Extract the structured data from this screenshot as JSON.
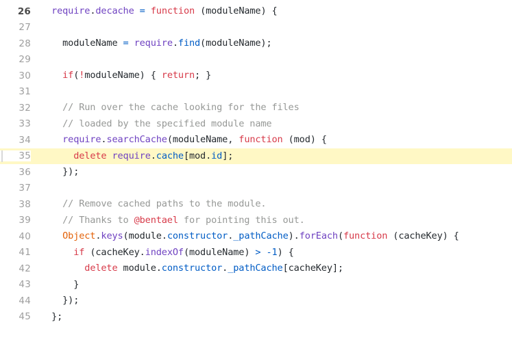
{
  "viewer": {
    "name": "code-blob-viewer",
    "language": "JavaScript",
    "first_line": 26,
    "last_line": 45,
    "highlighted_line": 35,
    "background": "#ffffff",
    "highlight_color": "#fff8c5",
    "gutter_marker_color": "#d8d8d8"
  },
  "colors": {
    "plain": "#24292e",
    "comment": "#969896",
    "keyword": "#d73a49",
    "identifier": "#6f42c1",
    "property": "#005cc5",
    "operator": "#005cc5",
    "number": "#005cc5",
    "global": "#e36209",
    "mention": "#d73a49",
    "line_number": "#9e9e9e"
  },
  "lines": [
    {
      "number": "26",
      "text": "require.decache = function (moduleName) {",
      "highlighted": false,
      "tokens": [
        {
          "t": "  ",
          "c": "plain"
        },
        {
          "t": "require",
          "c": "ident"
        },
        {
          "t": ".",
          "c": "punct"
        },
        {
          "t": "decache",
          "c": "ident"
        },
        {
          "t": " ",
          "c": "plain"
        },
        {
          "t": "=",
          "c": "op"
        },
        {
          "t": " ",
          "c": "plain"
        },
        {
          "t": "function",
          "c": "keyword"
        },
        {
          "t": " (moduleName) {",
          "c": "plain"
        }
      ]
    },
    {
      "number": "27",
      "text": "",
      "highlighted": false,
      "tokens": []
    },
    {
      "number": "28",
      "text": "  moduleName = require.find(moduleName);",
      "highlighted": false,
      "tokens": [
        {
          "t": "    moduleName ",
          "c": "plain"
        },
        {
          "t": "=",
          "c": "op"
        },
        {
          "t": " ",
          "c": "plain"
        },
        {
          "t": "require",
          "c": "ident"
        },
        {
          "t": ".",
          "c": "punct"
        },
        {
          "t": "find",
          "c": "prop"
        },
        {
          "t": "(moduleName);",
          "c": "plain"
        }
      ]
    },
    {
      "number": "29",
      "text": "",
      "highlighted": false,
      "tokens": []
    },
    {
      "number": "30",
      "text": "  if(!moduleName) { return; }",
      "highlighted": false,
      "tokens": [
        {
          "t": "    ",
          "c": "plain"
        },
        {
          "t": "if",
          "c": "keyword"
        },
        {
          "t": "(",
          "c": "punct"
        },
        {
          "t": "!",
          "c": "keyword"
        },
        {
          "t": "moduleName) { ",
          "c": "plain"
        },
        {
          "t": "return",
          "c": "keyword"
        },
        {
          "t": "; }",
          "c": "plain"
        }
      ]
    },
    {
      "number": "31",
      "text": "",
      "highlighted": false,
      "tokens": []
    },
    {
      "number": "32",
      "text": "  // Run over the cache looking for the files",
      "highlighted": false,
      "tokens": [
        {
          "t": "    ",
          "c": "plain"
        },
        {
          "t": "// Run over the cache looking for the files",
          "c": "comment"
        }
      ]
    },
    {
      "number": "33",
      "text": "  // loaded by the specified module name",
      "highlighted": false,
      "tokens": [
        {
          "t": "    ",
          "c": "plain"
        },
        {
          "t": "// loaded by the specified module name",
          "c": "comment"
        }
      ]
    },
    {
      "number": "34",
      "text": "  require.searchCache(moduleName, function (mod) {",
      "highlighted": false,
      "tokens": [
        {
          "t": "    ",
          "c": "plain"
        },
        {
          "t": "require",
          "c": "ident"
        },
        {
          "t": ".",
          "c": "punct"
        },
        {
          "t": "searchCache",
          "c": "ident"
        },
        {
          "t": "(moduleName, ",
          "c": "plain"
        },
        {
          "t": "function",
          "c": "keyword"
        },
        {
          "t": " (mod) {",
          "c": "plain"
        }
      ]
    },
    {
      "number": "35",
      "text": "    delete require.cache[mod.id];",
      "highlighted": true,
      "tokens": [
        {
          "t": "      ",
          "c": "plain"
        },
        {
          "t": "delete",
          "c": "keyword"
        },
        {
          "t": " ",
          "c": "plain"
        },
        {
          "t": "require",
          "c": "ident"
        },
        {
          "t": ".",
          "c": "punct"
        },
        {
          "t": "cache",
          "c": "prop"
        },
        {
          "t": "[mod.",
          "c": "plain"
        },
        {
          "t": "id",
          "c": "prop"
        },
        {
          "t": "];",
          "c": "plain"
        }
      ]
    },
    {
      "number": "36",
      "text": "  });",
      "highlighted": false,
      "tokens": [
        {
          "t": "    });",
          "c": "plain"
        }
      ]
    },
    {
      "number": "37",
      "text": "",
      "highlighted": false,
      "tokens": []
    },
    {
      "number": "38",
      "text": "  // Remove cached paths to the module.",
      "highlighted": false,
      "tokens": [
        {
          "t": "    ",
          "c": "plain"
        },
        {
          "t": "// Remove cached paths to the module.",
          "c": "comment"
        }
      ]
    },
    {
      "number": "39",
      "text": "  // Thanks to @bentael for pointing this out.",
      "highlighted": false,
      "tokens": [
        {
          "t": "    ",
          "c": "plain"
        },
        {
          "t": "// Thanks to ",
          "c": "comment"
        },
        {
          "t": "@bentael",
          "c": "mention"
        },
        {
          "t": " for pointing this out.",
          "c": "comment"
        }
      ]
    },
    {
      "number": "40",
      "text": "  Object.keys(module.constructor._pathCache).forEach(function (cacheKey) {",
      "highlighted": false,
      "tokens": [
        {
          "t": "    ",
          "c": "plain"
        },
        {
          "t": "Object",
          "c": "global"
        },
        {
          "t": ".",
          "c": "punct"
        },
        {
          "t": "keys",
          "c": "ident"
        },
        {
          "t": "(module.",
          "c": "plain"
        },
        {
          "t": "constructor",
          "c": "prop"
        },
        {
          "t": ".",
          "c": "punct"
        },
        {
          "t": "_pathCache",
          "c": "prop"
        },
        {
          "t": ").",
          "c": "plain"
        },
        {
          "t": "forEach",
          "c": "ident"
        },
        {
          "t": "(",
          "c": "punct"
        },
        {
          "t": "function",
          "c": "keyword"
        },
        {
          "t": " (cacheKey) {",
          "c": "plain"
        }
      ]
    },
    {
      "number": "41",
      "text": "    if (cacheKey.indexOf(moduleName) > -1) {",
      "highlighted": false,
      "tokens": [
        {
          "t": "      ",
          "c": "plain"
        },
        {
          "t": "if",
          "c": "keyword"
        },
        {
          "t": " (cacheKey.",
          "c": "plain"
        },
        {
          "t": "indexOf",
          "c": "ident"
        },
        {
          "t": "(moduleName) ",
          "c": "plain"
        },
        {
          "t": ">",
          "c": "op"
        },
        {
          "t": " ",
          "c": "plain"
        },
        {
          "t": "-1",
          "c": "num"
        },
        {
          "t": ") {",
          "c": "plain"
        }
      ]
    },
    {
      "number": "42",
      "text": "      delete module.constructor._pathCache[cacheKey];",
      "highlighted": false,
      "tokens": [
        {
          "t": "        ",
          "c": "plain"
        },
        {
          "t": "delete",
          "c": "keyword"
        },
        {
          "t": " module.",
          "c": "plain"
        },
        {
          "t": "constructor",
          "c": "prop"
        },
        {
          "t": ".",
          "c": "punct"
        },
        {
          "t": "_pathCache",
          "c": "prop"
        },
        {
          "t": "[cacheKey];",
          "c": "plain"
        }
      ]
    },
    {
      "number": "43",
      "text": "    }",
      "highlighted": false,
      "tokens": [
        {
          "t": "      }",
          "c": "plain"
        }
      ]
    },
    {
      "number": "44",
      "text": "  });",
      "highlighted": false,
      "tokens": [
        {
          "t": "    });",
          "c": "plain"
        }
      ]
    },
    {
      "number": "45",
      "text": "};",
      "highlighted": false,
      "tokens": [
        {
          "t": "  };",
          "c": "plain"
        }
      ]
    }
  ]
}
